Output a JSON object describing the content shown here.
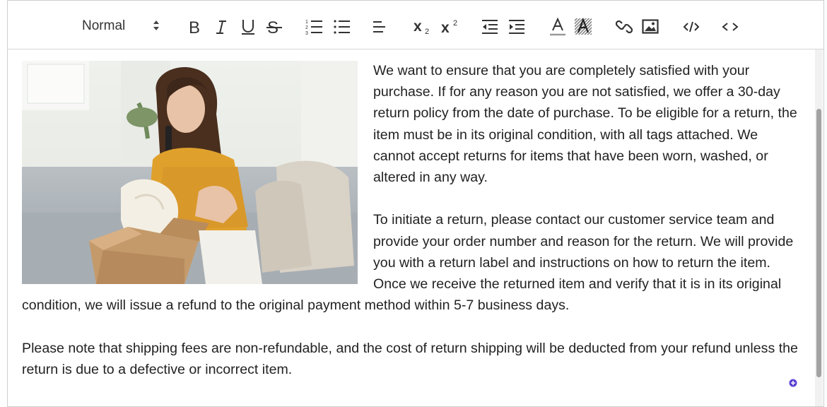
{
  "toolbar": {
    "format_select": {
      "value": "Normal"
    },
    "buttons": [
      {
        "icon": "bold-icon"
      },
      {
        "icon": "italic-icon"
      },
      {
        "icon": "underline-icon"
      },
      {
        "icon": "strikethrough-icon"
      },
      {
        "icon": "ordered-list-icon"
      },
      {
        "icon": "bullet-list-icon"
      },
      {
        "icon": "align-icon"
      },
      {
        "icon": "subscript-icon"
      },
      {
        "icon": "superscript-icon"
      },
      {
        "icon": "outdent-icon"
      },
      {
        "icon": "indent-icon"
      },
      {
        "icon": "text-color-icon"
      },
      {
        "icon": "background-color-icon"
      },
      {
        "icon": "link-icon"
      },
      {
        "icon": "image-icon"
      },
      {
        "icon": "code-icon"
      },
      {
        "icon": "html-source-icon"
      }
    ],
    "subscript_digit": "2",
    "superscript_digit": "2"
  },
  "content": {
    "paragraph_1": " We want to ensure that you are completely satisfied with your purchase. If for any reason you are not satisfied, we offer a 30-day return policy from the date of purchase. To be eligible for a return, the item must be in its original condition, with all tags attached. We cannot accept returns for items that have been worn, washed, or altered in any way.",
    "paragraph_2": "To initiate a return, please contact our customer service team and provide your order number and reason for the return. We will provide you with a return label and instructions on how to return the item. Once we receive the returned item and verify that it is in its original condition, we will issue a refund to the original payment method within 5-7 business days.",
    "paragraph_3": "Please note that shipping fees are non-refundable, and the cost of return shipping will be deducted from your refund unless the return is due to a defective or incorrect item."
  },
  "colors": {
    "accent": "#5b3fd6",
    "border": "#cfcfcf",
    "text": "#222222"
  }
}
